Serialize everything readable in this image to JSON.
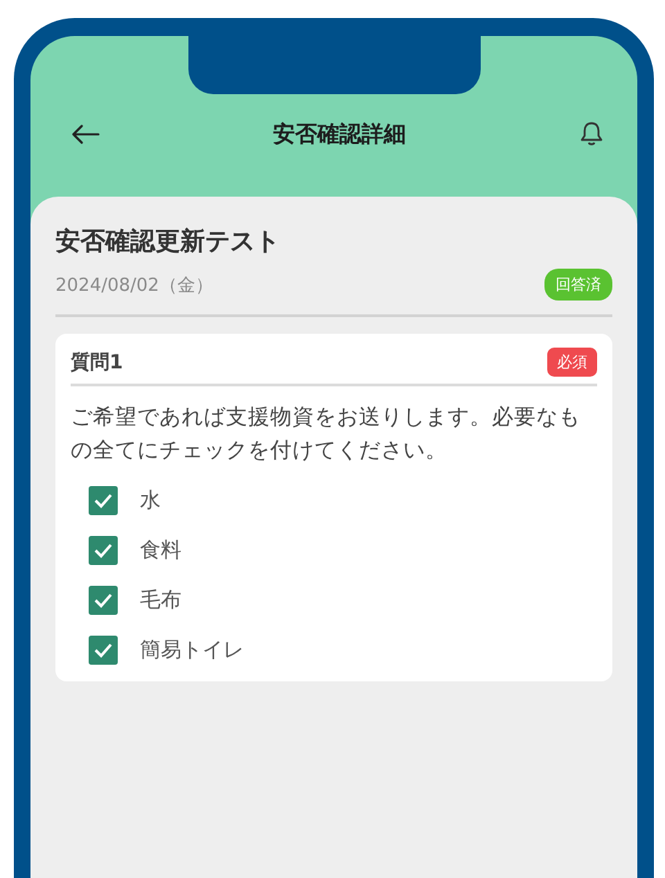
{
  "header": {
    "title": "安否確認詳細"
  },
  "survey": {
    "title": "安否確認更新テスト",
    "date": "2024/08/02（金）",
    "status": "回答済"
  },
  "question": {
    "label": "質問1",
    "badge": "必須",
    "text": "ご希望であれば支援物資をお送りします。必要なもの全てにチェックを付けてください。",
    "options": [
      {
        "label": "水",
        "checked": true
      },
      {
        "label": "食料",
        "checked": true
      },
      {
        "label": "毛布",
        "checked": true
      },
      {
        "label": "簡易トイレ",
        "checked": true
      }
    ]
  }
}
